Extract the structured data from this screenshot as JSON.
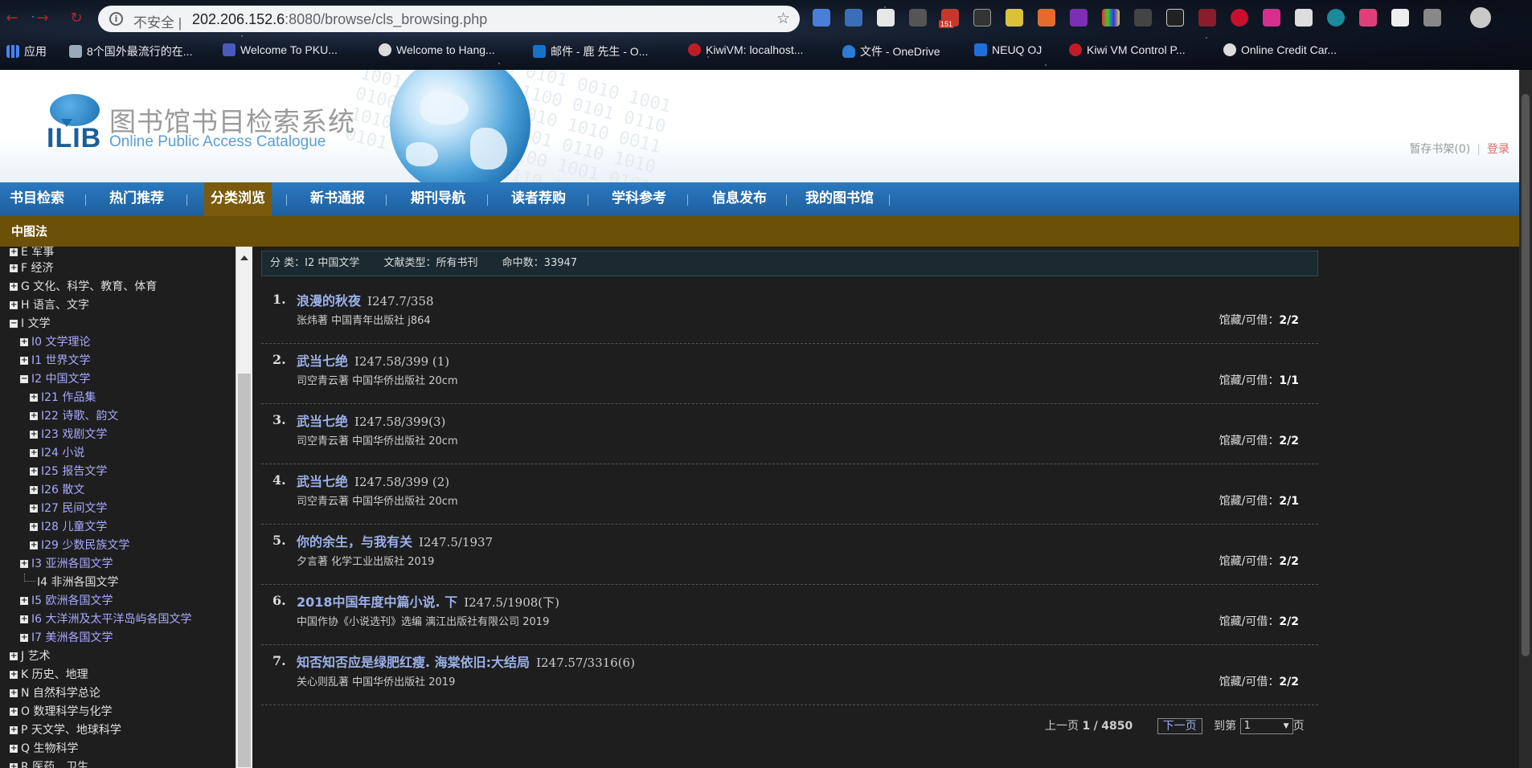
{
  "browser": {
    "insecure_label": "不安全",
    "url_host": "202.206.152.6",
    "url_rest": ":8080/browse/cls_browsing.php",
    "badge_count": "151",
    "bookmarks": [
      "应用",
      "8个国外最流行的在...",
      "Welcome To PKU...",
      "Welcome to Hang...",
      "邮件 - 鹿 先生 - O...",
      "KiwiVM: localhost...",
      "文件 - OneDrive",
      "NEUQ OJ",
      "Kiwi VM Control P...",
      "Online Credit Car..."
    ]
  },
  "header": {
    "logo_text": "ILIB",
    "title": "图书馆书目检索系统",
    "subtitle": "Online Public Access Catalogue",
    "shelf_link": "暂存书架(0)",
    "login_link": "登录"
  },
  "nav": {
    "items": [
      "书目检索",
      "热门推荐",
      "分类浏览",
      "新书通报",
      "期刊导航",
      "读者荐购",
      "学科参考",
      "信息发布",
      "我的图书馆"
    ],
    "active": "分类浏览"
  },
  "section": {
    "title": "中图法"
  },
  "tree": [
    "E 军事",
    "F 经济",
    "G 文化、科学、教育、体育",
    "H 语言、文字",
    "I 文学",
    "I0 文学理论",
    "I1 世界文学",
    "I2 中国文学",
    "I21 作品集",
    "I22 诗歌、韵文",
    "I23 戏剧文学",
    "I24 小说",
    "I25 报告文学",
    "I26 散文",
    "I27 民间文学",
    "I28 儿童文学",
    "I29 少数民族文学",
    "I3 亚洲各国文学",
    "I4 非洲各国文学",
    "I5 欧洲各国文学",
    "I6 大洋洲及太平洋岛屿各国文学",
    "I7 美洲各国文学",
    "J 艺术",
    "K 历史、地理",
    "N 自然科学总论",
    "O 数理科学与化学",
    "P 天文学、地球科学",
    "Q 生物科学",
    "R 医药、卫生"
  ],
  "summary": {
    "category": "分 类：I2 中国文学",
    "doc_type": "文献类型：所有书刊",
    "hits": "命中数：33947"
  },
  "results": [
    {
      "num": "1.",
      "title": "浪漫的秋夜",
      "callno": "I247.7/358",
      "meta": "张炜著 中国青年出版社 j864",
      "holdings_label": "馆藏/可借：",
      "holdings": "2/2"
    },
    {
      "num": "2.",
      "title": "武当七绝",
      "callno": "I247.58/399 (1)",
      "meta": "司空青云著 中国华侨出版社 20cm",
      "holdings_label": "馆藏/可借：",
      "holdings": "1/1"
    },
    {
      "num": "3.",
      "title": "武当七绝",
      "callno": "I247.58/399(3)",
      "meta": "司空青云著 中国华侨出版社 20cm",
      "holdings_label": "馆藏/可借：",
      "holdings": "2/2"
    },
    {
      "num": "4.",
      "title": "武当七绝",
      "callno": "I247.58/399 (2)",
      "meta": "司空青云著 中国华侨出版社 20cm",
      "holdings_label": "馆藏/可借：",
      "holdings": "2/1"
    },
    {
      "num": "5.",
      "title": "你的余生，与我有关",
      "callno": "I247.5/1937",
      "meta": "夕言著 化学工业出版社 2019",
      "holdings_label": "馆藏/可借：",
      "holdings": "2/2"
    },
    {
      "num": "6.",
      "title": "2018中国年度中篇小说. 下",
      "callno": "I247.5/1908(下)",
      "meta": "中国作协《小说选刊》选编 漓江出版社有限公司 2019",
      "holdings_label": "馆藏/可借：",
      "holdings": "2/2"
    },
    {
      "num": "7.",
      "title": "知否知否应是绿肥红瘦. 海棠依旧:大结局",
      "callno": "I247.57/3316(6)",
      "meta": "关心则乱著 中国华侨出版社 2019",
      "holdings_label": "馆藏/可借：",
      "holdings": "2/2"
    }
  ],
  "pager": {
    "prev": "上一页",
    "current": "1",
    "separator": "/",
    "total": "4850",
    "next": "下一页",
    "goto_label": "到第",
    "goto_value": "1",
    "page_suffix": "页"
  },
  "colors": {
    "nav_blue": "#2a79bf",
    "active_tab": "#7a5b0d",
    "section_bar": "#6b5008",
    "link": "#9bb0e8"
  }
}
